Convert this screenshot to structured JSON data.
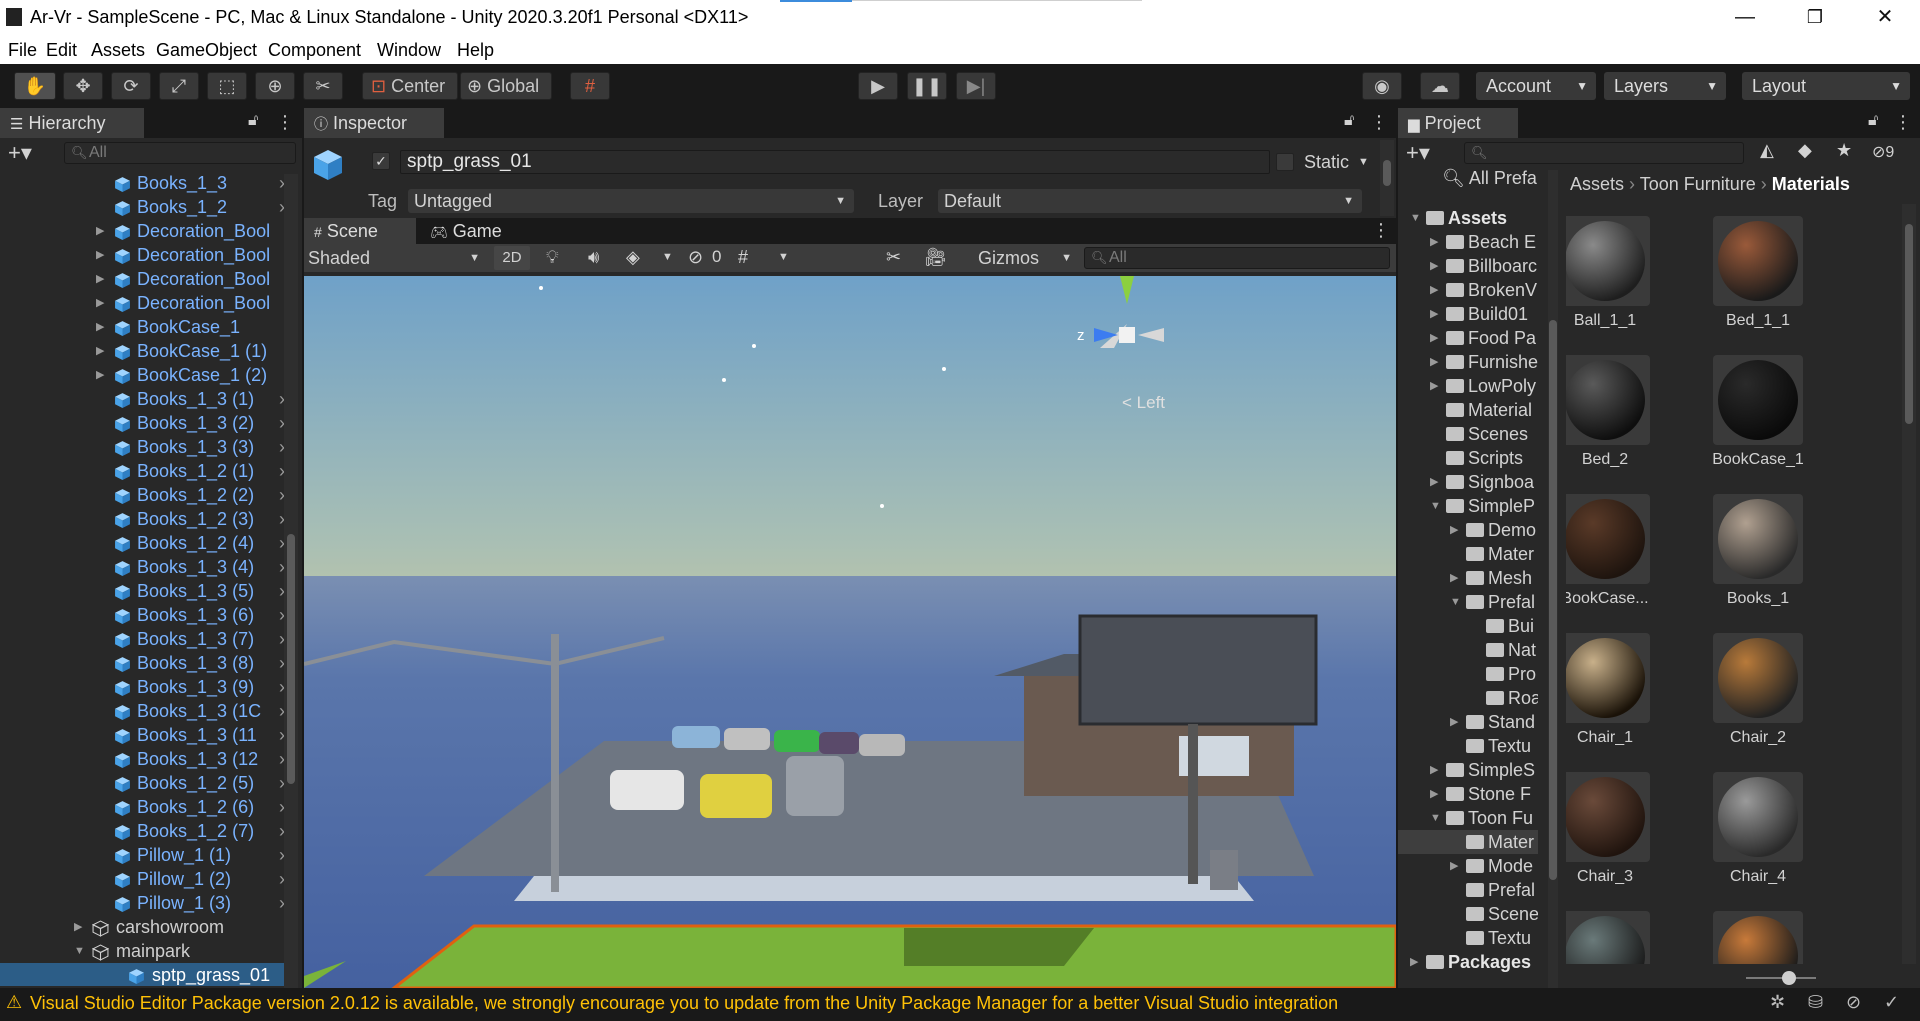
{
  "window": {
    "title": "Ar-Vr - SampleScene - PC, Mac & Linux Standalone - Unity 2020.3.20f1 Personal <DX11>",
    "minimize": "—",
    "restore": "❐",
    "close": "✕"
  },
  "menu": [
    "File",
    "Edit",
    "Assets",
    "GameObject",
    "Component",
    "Window",
    "Help"
  ],
  "toolbar": {
    "pivot": "Center",
    "space": "Global",
    "account": "Account",
    "layers": "Layers",
    "layout": "Layout"
  },
  "hierarchy": {
    "tab": "Hierarchy",
    "search_placeholder": "All",
    "rows": [
      {
        "label": "Books_1_3",
        "fold": "",
        "chev": "›"
      },
      {
        "label": "Books_1_2",
        "fold": "",
        "chev": "›"
      },
      {
        "label": "Decoration_Bool",
        "fold": "▶",
        "chev": ""
      },
      {
        "label": "Decoration_Bool",
        "fold": "▶",
        "chev": ""
      },
      {
        "label": "Decoration_Bool",
        "fold": "▶",
        "chev": ""
      },
      {
        "label": "Decoration_Bool",
        "fold": "▶",
        "chev": ""
      },
      {
        "label": "BookCase_1",
        "fold": "▶",
        "chev": ""
      },
      {
        "label": "BookCase_1 (1)",
        "fold": "▶",
        "chev": ""
      },
      {
        "label": "BookCase_1 (2)",
        "fold": "▶",
        "chev": ""
      },
      {
        "label": "Books_1_3 (1)",
        "fold": "",
        "chev": "›"
      },
      {
        "label": "Books_1_3 (2)",
        "fold": "",
        "chev": "›"
      },
      {
        "label": "Books_1_3 (3)",
        "fold": "",
        "chev": "›"
      },
      {
        "label": "Books_1_2 (1)",
        "fold": "",
        "chev": "›"
      },
      {
        "label": "Books_1_2 (2)",
        "fold": "",
        "chev": "›"
      },
      {
        "label": "Books_1_2 (3)",
        "fold": "",
        "chev": "›"
      },
      {
        "label": "Books_1_2 (4)",
        "fold": "",
        "chev": "›"
      },
      {
        "label": "Books_1_3 (4)",
        "fold": "",
        "chev": "›"
      },
      {
        "label": "Books_1_3 (5)",
        "fold": "",
        "chev": "›"
      },
      {
        "label": "Books_1_3 (6)",
        "fold": "",
        "chev": "›"
      },
      {
        "label": "Books_1_3 (7)",
        "fold": "",
        "chev": "›"
      },
      {
        "label": "Books_1_3 (8)",
        "fold": "",
        "chev": "›"
      },
      {
        "label": "Books_1_3 (9)",
        "fold": "",
        "chev": "›"
      },
      {
        "label": "Books_1_3 (1C",
        "fold": "",
        "chev": "›"
      },
      {
        "label": "Books_1_3 (11",
        "fold": "",
        "chev": "›"
      },
      {
        "label": "Books_1_3 (12",
        "fold": "",
        "chev": "›"
      },
      {
        "label": "Books_1_2 (5)",
        "fold": "",
        "chev": "›"
      },
      {
        "label": "Books_1_2 (6)",
        "fold": "",
        "chev": "›"
      },
      {
        "label": "Books_1_2 (7)",
        "fold": "",
        "chev": "›"
      },
      {
        "label": "Pillow_1 (1)",
        "fold": "",
        "chev": "›"
      },
      {
        "label": "Pillow_1 (2)",
        "fold": "",
        "chev": "›"
      },
      {
        "label": "Pillow_1 (3)",
        "fold": "",
        "chev": "›"
      }
    ],
    "carshowroom": "carshowroom",
    "mainpark": "mainpark",
    "selected": "sptp_grass_01"
  },
  "inspector": {
    "tab": "Inspector",
    "object_name": "sptp_grass_01",
    "static_label": "Static",
    "tag_label": "Tag",
    "tag_value": "Untagged",
    "layer_label": "Layer",
    "layer_value": "Default"
  },
  "scene": {
    "tab_scene": "Scene",
    "tab_game": "Game",
    "shading": "Shaded",
    "mode_2d": "2D",
    "hidden_count": "0",
    "gizmos": "Gizmos",
    "search_placeholder": "All",
    "gizmo_y": "y",
    "gizmo_z": "z",
    "gizmo_view": "Left"
  },
  "project": {
    "tab": "Project",
    "hidden_count": "9",
    "favorites": "All Prefa",
    "breadcrumb": [
      "Assets",
      "Toon Furniture",
      "Materials"
    ],
    "tree": [
      {
        "label": "Assets",
        "fold": "▼",
        "indent": 0,
        "bold": true
      },
      {
        "label": "Beach E",
        "fold": "▶",
        "indent": 1
      },
      {
        "label": "Billboarc",
        "fold": "▶",
        "indent": 1
      },
      {
        "label": "BrokenV",
        "fold": "▶",
        "indent": 1
      },
      {
        "label": "Build01",
        "fold": "▶",
        "indent": 1
      },
      {
        "label": "Food Pa",
        "fold": "▶",
        "indent": 1
      },
      {
        "label": "Furnishe",
        "fold": "▶",
        "indent": 1
      },
      {
        "label": "LowPoly",
        "fold": "▶",
        "indent": 1
      },
      {
        "label": "Material",
        "fold": "",
        "indent": 1
      },
      {
        "label": "Scenes",
        "fold": "",
        "indent": 1
      },
      {
        "label": "Scripts",
        "fold": "",
        "indent": 1
      },
      {
        "label": "Signboa",
        "fold": "▶",
        "indent": 1
      },
      {
        "label": "SimpleP",
        "fold": "▼",
        "indent": 1
      },
      {
        "label": "Demo",
        "fold": "▶",
        "indent": 2
      },
      {
        "label": "Mater",
        "fold": "",
        "indent": 2
      },
      {
        "label": "Mesh",
        "fold": "▶",
        "indent": 2
      },
      {
        "label": "Prefal",
        "fold": "▼",
        "indent": 2
      },
      {
        "label": "Bui",
        "fold": "",
        "indent": 3
      },
      {
        "label": "Nat",
        "fold": "",
        "indent": 3
      },
      {
        "label": "Pro",
        "fold": "",
        "indent": 3
      },
      {
        "label": "Roa",
        "fold": "",
        "indent": 3
      },
      {
        "label": "Stand",
        "fold": "▶",
        "indent": 2
      },
      {
        "label": "Textu",
        "fold": "",
        "indent": 2
      },
      {
        "label": "SimpleS",
        "fold": "▶",
        "indent": 1
      },
      {
        "label": "Stone F",
        "fold": "▶",
        "indent": 1
      },
      {
        "label": "Toon Fu",
        "fold": "▼",
        "indent": 1
      },
      {
        "label": "Mater",
        "fold": "",
        "indent": 2,
        "selected": true
      },
      {
        "label": "Mode",
        "fold": "▶",
        "indent": 2
      },
      {
        "label": "Prefal",
        "fold": "",
        "indent": 2
      },
      {
        "label": "Scene",
        "fold": "",
        "indent": 2
      },
      {
        "label": "Textu",
        "fold": "",
        "indent": 2
      },
      {
        "label": "Packages",
        "fold": "▶",
        "indent": 0,
        "bold": true
      }
    ],
    "assets": [
      {
        "name": "Ball_1_1",
        "c1": "#8a8a8a",
        "c2": "#1e1e1e"
      },
      {
        "name": "Bed_1_1",
        "c1": "#9a5a3a",
        "c2": "#1a1a1a"
      },
      {
        "name": "Bed_2",
        "c1": "#5a5a5a",
        "c2": "#0e0e0e"
      },
      {
        "name": "BookCase_1",
        "c1": "#2a2a2a",
        "c2": "#0a0a0a"
      },
      {
        "name": "BookCase...",
        "c1": "#5a3a28",
        "c2": "#1e140e"
      },
      {
        "name": "Books_1",
        "c1": "#b0a090",
        "c2": "#2a2a2a"
      },
      {
        "name": "Chair_1",
        "c1": "#c8b08a",
        "c2": "#1a1208"
      },
      {
        "name": "Chair_2",
        "c1": "#b87a3a",
        "c2": "#222222"
      },
      {
        "name": "Chair_3",
        "c1": "#6a4a3a",
        "c2": "#20140e"
      },
      {
        "name": "Chair_4",
        "c1": "#9a9a9a",
        "c2": "#2a2a2a"
      }
    ]
  },
  "status": {
    "message": "Visual Studio Editor Package version 2.0.12 is available, we strongly encourage you to update from the Unity Package Manager for a better Visual Studio integration"
  },
  "colors": {
    "accent_selection": "#2c5d87",
    "link_blue": "#7ab3ff",
    "warning": "#ffc107",
    "sky_top": "#6fa1c8",
    "sky_horizon": "#c8c8a0",
    "ground": "#4b6ca8",
    "grass": "#7ab33a"
  }
}
